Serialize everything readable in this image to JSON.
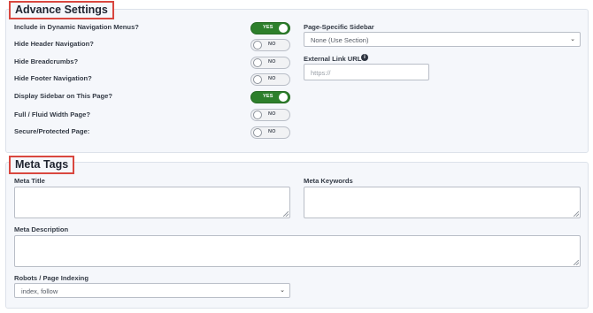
{
  "advanced": {
    "title": "Advance Settings",
    "rows": [
      {
        "label": "Include in Dynamic Navigation Menus?",
        "state": "YES"
      },
      {
        "label": "Hide Header Navigation?",
        "state": "NO"
      },
      {
        "label": "Hide Breadcrumbs?",
        "state": "NO"
      },
      {
        "label": "Hide Footer Navigation?",
        "state": "NO"
      },
      {
        "label": "Display Sidebar on This Page?",
        "state": "YES"
      },
      {
        "label": "Full / Fluid Width Page?",
        "state": "NO"
      },
      {
        "label": "Secure/Protected Page:",
        "state": "NO"
      }
    ],
    "sidebar": {
      "label": "Page-Specific Sidebar",
      "value": "None (Use Section)"
    },
    "external": {
      "label": "External Link URL",
      "placeholder": "https://"
    }
  },
  "meta": {
    "title": "Meta Tags",
    "meta_title_label": "Meta Title",
    "meta_keywords_label": "Meta Keywords",
    "meta_description_label": "Meta Description",
    "robots_label": "Robots / Page Indexing",
    "robots_value": "index, follow"
  },
  "colors": {
    "toggle_on": "#2d7f2b",
    "highlight_border": "#d9473f"
  }
}
